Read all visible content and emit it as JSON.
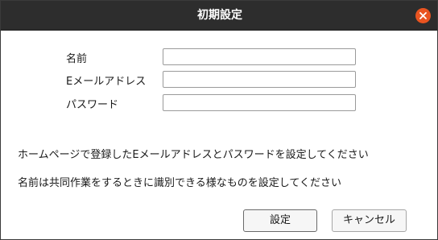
{
  "window": {
    "title": "初期設定",
    "close_icon": "close-icon",
    "close_color": "#e95420",
    "titlebar_color": "#2d2d2d"
  },
  "form": {
    "name_label": "名前",
    "email_label": "Eメールアドレス",
    "password_label": "パスワード",
    "name_value": "",
    "email_value": "",
    "password_value": ""
  },
  "messages": {
    "line1": "ホームページで登録したEメールアドレスとパスワードを設定してください",
    "line2": "名前は共同作業をするときに識別できる様なものを設定してください"
  },
  "buttons": {
    "ok_label": "設定",
    "cancel_label": "キャンセル"
  }
}
